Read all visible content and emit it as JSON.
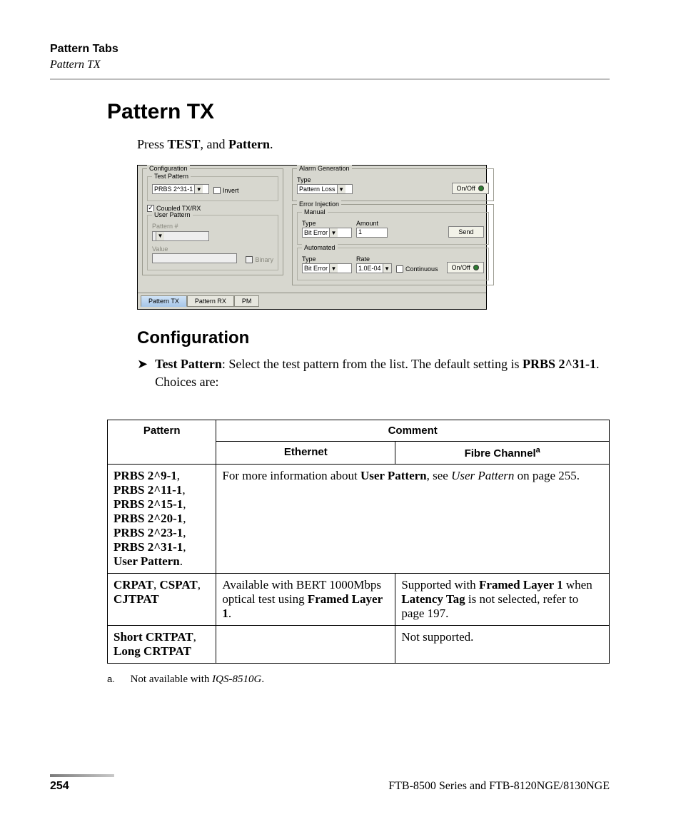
{
  "runhead": {
    "title": "Pattern Tabs",
    "sub": "Pattern TX"
  },
  "section_title": "Pattern TX",
  "intro": {
    "lead": "Press ",
    "b1": "TEST",
    "mid": ", and ",
    "b2": "Pattern",
    "trail": "."
  },
  "shot": {
    "config_title": "Configuration",
    "test_pattern_title": "Test Pattern",
    "test_pattern_value": "PRBS 2^31-1",
    "invert_label": "Invert",
    "coupled_label": "Coupled TX/RX",
    "coupled_check": "✓",
    "user_pattern_title": "User Pattern",
    "pattern_num_label": "Pattern #",
    "value_label": "Value",
    "binary_label": "Binary",
    "alarm_title": "Alarm Generation",
    "alarm_type_label": "Type",
    "alarm_type_value": "Pattern Loss",
    "onoff_label": "On/Off",
    "err_title": "Error Injection",
    "manual_title": "Manual",
    "err_type_label": "Type",
    "err_type_value": "Bit Error",
    "amount_label": "Amount",
    "amount_value": "1",
    "send_label": "Send",
    "auto_title": "Automated",
    "auto_type_label": "Type",
    "auto_type_value": "Bit Error",
    "rate_label": "Rate",
    "rate_value": "1.0E-04",
    "continuous_label": "Continuous",
    "tabs": {
      "tx": "Pattern TX",
      "rx": "Pattern RX",
      "pm": "PM"
    }
  },
  "subsection_title": "Configuration",
  "bullet": {
    "lead_b": "Test Pattern",
    "lead_rest": ": Select the test pattern from the list. The default setting is ",
    "default_b": "PRBS 2^31-1",
    "trail": ". Choices are:"
  },
  "table": {
    "h_comment": "Comment",
    "h_pattern": "Pattern",
    "h_eth": "Ethernet",
    "h_fc": "Fibre Channel",
    "h_fc_sup": "a",
    "r1_pat_a": "PRBS 2^9-1",
    "r1_pat_b": "PRBS 2^11-1",
    "r1_pat_c": "PRBS 2^15-1",
    "r1_pat_d": "PRBS 2^20-1",
    "r1_pat_e": "PRBS 2^23-1",
    "r1_pat_f": "PRBS 2^31-1",
    "r1_pat_g": "User Pattern",
    "r1_c_lead": "For more information about ",
    "r1_c_b": "User Pattern",
    "r1_c_mid": ", see ",
    "r1_c_i": "User Pattern",
    "r1_c_trail": " on page 255.",
    "r2_pat_a": "CRPAT",
    "r2_pat_b": "CSPAT",
    "r2_pat_c": "CJTPAT",
    "r2_eth_lead": "Available with BERT 1000Mbps optical test using ",
    "r2_eth_b": "Framed Layer 1",
    "r2_eth_trail": ".",
    "r2_fc_lead": "Supported with ",
    "r2_fc_b1": "Framed Layer 1",
    "r2_fc_mid1": " when ",
    "r2_fc_b2": "Latency Tag",
    "r2_fc_trail": " is not selected, refer to page 197.",
    "r3_pat_a": "Short CRTPAT",
    "r3_pat_b": "Long CRTPAT",
    "r3_eth": "",
    "r3_fc": "Not supported."
  },
  "footnote": {
    "tag": "a.",
    "lead": "Not available with ",
    "i": "IQS-8510G",
    "trail": "."
  },
  "footer": {
    "page": "254",
    "book": "FTB-8500 Series and FTB-8120NGE/8130NGE"
  }
}
